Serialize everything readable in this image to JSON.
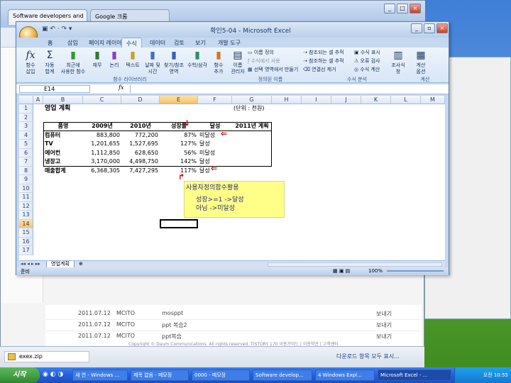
{
  "browser": {
    "tabs": [
      "Software developers and",
      "Google 크롬"
    ],
    "list_rows": [
      {
        "date": "2011.07.12",
        "author": "MCITO",
        "title": "mosppt",
        "action": "보내기"
      },
      {
        "date": "2011.07.12",
        "author": "MCITO",
        "title": "ppt 복습2",
        "action": "보내기"
      },
      {
        "date": "2011.07.12",
        "author": "MCITO",
        "title": "ppt복습",
        "action": "보내기"
      }
    ],
    "copyright": "Copyright © Daum Communications. All rights reserved. TISTORY 170  이용가이드 | 이용약관 | 고객센터",
    "download_file": "exex.zip",
    "download_show_all": "다운로드 항목 모두 표시..."
  },
  "excel": {
    "title": "확인5-04 - Microsoft Excel",
    "ribbon_tabs": [
      "홈",
      "삽입",
      "페이지 레이아웃",
      "수식",
      "데이터",
      "검토",
      "보기",
      "개발 도구"
    ],
    "active_tab": "수식",
    "ribbon": {
      "insert_function": "함수\n삽입",
      "autosum": "자동\n합계",
      "recent": "최근에\n사용한 함수",
      "financial": "재무",
      "logical": "논리",
      "text": "텍스트",
      "datetime": "날짜 및\n시간",
      "lookup": "찾기/참조\n영역",
      "math": "수학/삼각",
      "more": "함수\n추가",
      "group_library": "함수 라이브러리",
      "name_manager": "이름\n관리자",
      "define_name": "이름 정의",
      "use_in_formula": "수식에서 사용",
      "create_from_selection": "선택 영역에서 만들기",
      "group_names": "정의된 이름",
      "trace_precedents": "참조되는 셀 추적",
      "trace_dependents": "참조하는 셀 추적",
      "remove_arrows": "연결선 제거",
      "show_formulas": "수식 표시",
      "error_checking": "오류 검사",
      "evaluate": "수식 계산",
      "watch": "조사식\n창",
      "group_audit": "수식 분석",
      "calc_options": "계산\n옵션",
      "group_calc": "계산"
    },
    "name_box": "E14",
    "fx": "fx",
    "columns": [
      "A",
      "B",
      "C",
      "D",
      "E",
      "F",
      "G",
      "H",
      "I",
      "J",
      "K",
      "L",
      "M"
    ],
    "rows": [
      "1",
      "2",
      "3",
      "4",
      "5",
      "6",
      "7",
      "8",
      "9",
      "10",
      "11",
      "12",
      "13",
      "14",
      "15",
      "16",
      "17"
    ],
    "sheet_title": "영업 계획",
    "unit": "(단위 : 천원)",
    "headers": [
      "품명",
      "2009년",
      "2010년",
      "성장률",
      "달성",
      "2011년 계획"
    ],
    "table": [
      [
        "컴퓨터",
        "883,800",
        "772,200",
        "87%",
        "미달성"
      ],
      [
        "TV",
        "1,201,655",
        "1,527,695",
        "127%",
        "달성"
      ],
      [
        "에어컨",
        "1,112,850",
        "628,650",
        "56%",
        "미달성"
      ],
      [
        "냉장고",
        "3,170,000",
        "4,498,750",
        "142%",
        "달성"
      ],
      [
        "매출합계",
        "6,368,305",
        "7,427,295",
        "117%",
        "달성"
      ]
    ],
    "note": {
      "title": "사용자정의함수활용",
      "line1": "성장>=1  ->달성",
      "line2": "아님  ->미달성"
    },
    "sheet_tab": "영업계획",
    "status_left": "준비",
    "zoom": "100%"
  },
  "taskbar": {
    "start": "시작",
    "buttons": [
      "새 연 - Windows ...",
      "제목 없음 - 메모장",
      "0000 - 메모장",
      "Software develop...",
      "4 Windows Expl...",
      "Microsoft Excel - ..."
    ],
    "clock": "오전 10:55"
  }
}
